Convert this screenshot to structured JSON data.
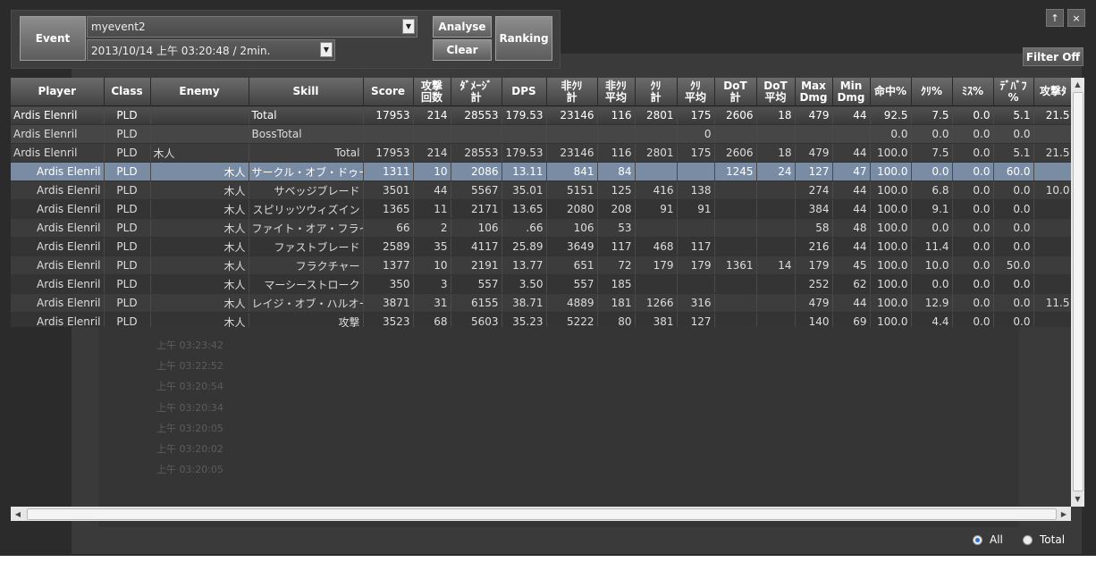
{
  "toolbar": {
    "event_label": "Event",
    "event_name": "myevent2",
    "event_time": "2013/10/14 上午 03:20:48 / 2min.",
    "analyse_label": "Analyse",
    "clear_label": "Clear",
    "ranking_label": "Ranking"
  },
  "window": {
    "pin_label": "↑",
    "close_label": "×",
    "filter_label": "Filter Off"
  },
  "columns": [
    "Player",
    "Class",
    "Enemy",
    "Skill",
    "Score",
    "攻撃\n回数",
    "ﾀﾞﾒｰｼﾞ\n計",
    "DPS",
    "非ｸﾘ\n計",
    "非ｸﾘ\n平均",
    "ｸﾘ\n計",
    "ｸﾘ\n平均",
    "DoT\n計",
    "DoT\n平均",
    "Max\nDmg",
    "Min\nDmg",
    "命中%",
    "ｸﾘ%",
    "ﾐｽ%",
    "ﾃﾞﾊﾞﾌ\n%",
    "攻撃ﾀ"
  ],
  "rows": [
    [
      "Ardis Elenril",
      "PLD",
      "",
      "Total",
      "17953",
      "214",
      "28553",
      "179.53",
      "23146",
      "116",
      "2801",
      "175",
      "2606",
      "18",
      "479",
      "44",
      "92.5",
      "7.5",
      "0.0",
      "5.1",
      "21.5"
    ],
    [
      "Ardis Elenril",
      "PLD",
      "",
      "BossTotal",
      "",
      "",
      "",
      "",
      "",
      "",
      "",
      "0",
      "",
      "",
      "",
      "",
      "0.0",
      "0.0",
      "0.0",
      "0.0",
      ""
    ],
    [
      "Ardis Elenril",
      "PLD",
      "木人",
      "Total",
      "17953",
      "214",
      "28553",
      "179.53",
      "23146",
      "116",
      "2801",
      "175",
      "2606",
      "18",
      "479",
      "44",
      "100.0",
      "7.5",
      "0.0",
      "5.1",
      "21.5"
    ],
    [
      "Ardis Elenril",
      "PLD",
      "木人",
      "サークル・オブ・ドゥーム",
      "1311",
      "10",
      "2086",
      "13.11",
      "841",
      "84",
      "",
      "",
      "1245",
      "24",
      "127",
      "47",
      "100.0",
      "0.0",
      "0.0",
      "60.0",
      ""
    ],
    [
      "Ardis Elenril",
      "PLD",
      "木人",
      "サベッジブレード",
      "3501",
      "44",
      "5567",
      "35.01",
      "5151",
      "125",
      "416",
      "138",
      "",
      "",
      "274",
      "44",
      "100.0",
      "6.8",
      "0.0",
      "0.0",
      "10.0"
    ],
    [
      "Ardis Elenril",
      "PLD",
      "木人",
      "スピリッツウィズイン",
      "1365",
      "11",
      "2171",
      "13.65",
      "2080",
      "208",
      "91",
      "91",
      "",
      "",
      "384",
      "44",
      "100.0",
      "9.1",
      "0.0",
      "0.0",
      ""
    ],
    [
      "Ardis Elenril",
      "PLD",
      "木人",
      "ファイト・オア・フライト",
      "66",
      "2",
      "106",
      ".66",
      "106",
      "53",
      "",
      "",
      "",
      "",
      "58",
      "48",
      "100.0",
      "0.0",
      "0.0",
      "0.0",
      ""
    ],
    [
      "Ardis Elenril",
      "PLD",
      "木人",
      "ファストブレード",
      "2589",
      "35",
      "4117",
      "25.89",
      "3649",
      "117",
      "468",
      "117",
      "",
      "",
      "216",
      "44",
      "100.0",
      "11.4",
      "0.0",
      "0.0",
      ""
    ],
    [
      "Ardis Elenril",
      "PLD",
      "木人",
      "フラクチャー",
      "1377",
      "10",
      "2191",
      "13.77",
      "651",
      "72",
      "179",
      "179",
      "1361",
      "14",
      "179",
      "45",
      "100.0",
      "10.0",
      "0.0",
      "50.0",
      ""
    ],
    [
      "Ardis Elenril",
      "PLD",
      "木人",
      "マーシーストローク",
      "350",
      "3",
      "557",
      "3.50",
      "557",
      "185",
      "",
      "",
      "",
      "",
      "252",
      "62",
      "100.0",
      "0.0",
      "0.0",
      "0.0",
      ""
    ],
    [
      "Ardis Elenril",
      "PLD",
      "木人",
      "レイジ・オブ・ハルオーネ",
      "3871",
      "31",
      "6155",
      "38.71",
      "4889",
      "181",
      "1266",
      "316",
      "",
      "",
      "479",
      "44",
      "100.0",
      "12.9",
      "0.0",
      "0.0",
      "11.5"
    ],
    [
      "Ardis Elenril",
      "PLD",
      "木人",
      "攻撃",
      "3523",
      "68",
      "5603",
      "35.23",
      "5222",
      "80",
      "381",
      "127",
      "",
      "",
      "140",
      "69",
      "100.0",
      "4.4",
      "0.0",
      "0.0",
      ""
    ]
  ],
  "background_log": [
    "上午 03:23:42",
    "上午 03:22:52",
    "上午 03:20:54",
    "上午 03:20:34",
    "上午 03:20:05",
    "上午 03:20:02",
    "上午 03:20:05"
  ],
  "filter": {
    "all_label": "All",
    "total_label": "Total",
    "selected": "All"
  }
}
